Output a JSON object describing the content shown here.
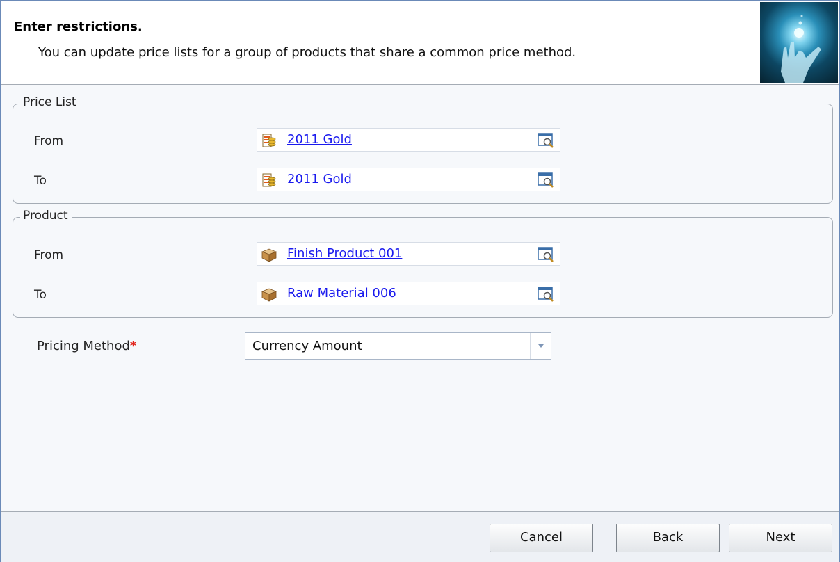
{
  "header": {
    "title": "Enter restrictions.",
    "description": "You can update price lists for a group of products that share a common price method."
  },
  "price_list": {
    "legend": "Price List",
    "from": {
      "label": "From",
      "value": "2011 Gold",
      "icon": "price-list-icon"
    },
    "to": {
      "label": "To",
      "value": "2011 Gold",
      "icon": "price-list-icon"
    }
  },
  "product": {
    "legend": "Product",
    "from": {
      "label": "From",
      "value": "Finish Product 001",
      "icon": "product-box-icon"
    },
    "to": {
      "label": "To",
      "value": "Raw Material 006",
      "icon": "product-box-icon"
    }
  },
  "pricing_method": {
    "label": "Pricing Method",
    "required_marker": "*",
    "selected": "Currency Amount"
  },
  "buttons": {
    "cancel": "Cancel",
    "back": "Back",
    "next": "Next"
  },
  "colors": {
    "link": "#1a1aee",
    "required": "#e2231a",
    "border": "#a5acb5"
  }
}
